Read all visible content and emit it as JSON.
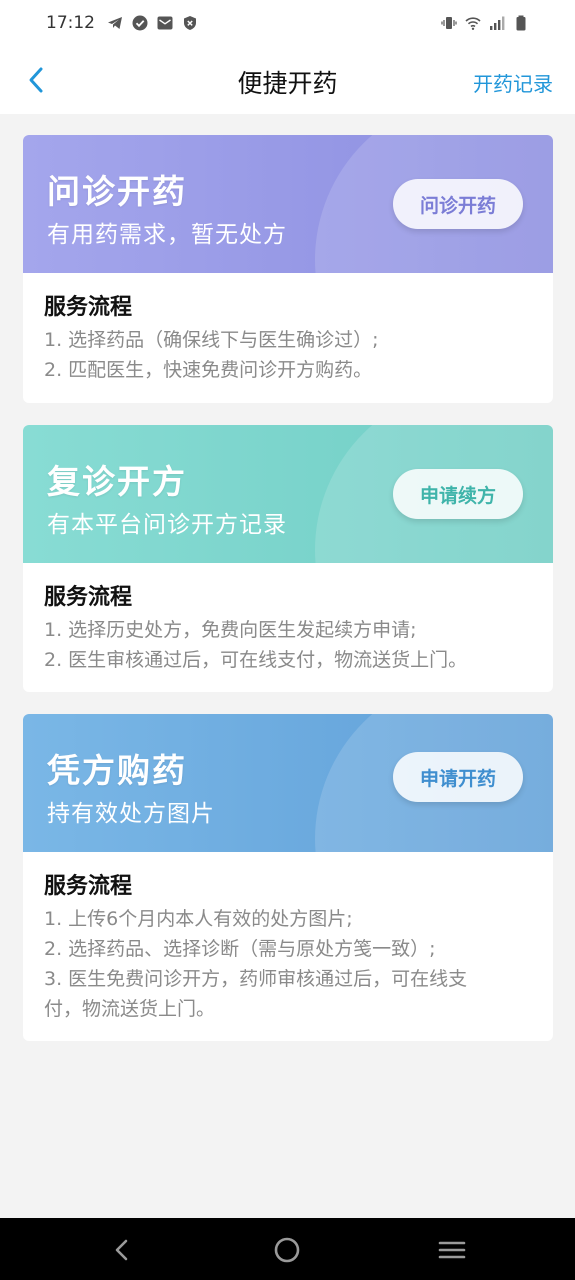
{
  "status_bar": {
    "time": "17:12",
    "left_icons": [
      "telegram-icon",
      "check-circle-icon",
      "mail-icon",
      "shield-icon"
    ],
    "right_icons": [
      "vibrate-icon",
      "wifi-icon",
      "signal-icon",
      "battery-icon"
    ]
  },
  "nav": {
    "back_icon": "chevron-left-icon",
    "title": "便捷开药",
    "right_link": "开药记录"
  },
  "cards": [
    {
      "title": "问诊开药",
      "subtitle": "有用药需求，暂无处方",
      "button": "问诊开药",
      "flow_title": "服务流程",
      "steps": [
        "1. 选择药品（确保线下与医生确诊过）;",
        "2. 匹配医生，快速免费问诊开方购药。"
      ],
      "accent": "#8e8fe0",
      "button_text_color": "#7b7dd6"
    },
    {
      "title": "复诊开方",
      "subtitle": "有本平台问诊开方记录",
      "button": "申请续方",
      "flow_title": "服务流程",
      "steps": [
        "1. 选择历史处方，免费向医生发起续方申请;",
        "2. 医生审核通过后，可在线支付，物流送货上门。"
      ],
      "accent": "#6fcdc4",
      "button_text_color": "#3fb4aa"
    },
    {
      "title": "凭方购药",
      "subtitle": "持有效处方图片",
      "button": "申请开药",
      "flow_title": "服务流程",
      "steps": [
        "1. 上传6个月内本人有效的处方图片;",
        "2. 选择药品、选择诊断（需与原处方笺一致）;",
        "3. 医生免费问诊开方，药师审核通过后，可在线支",
        "付，物流送货上门。"
      ],
      "accent": "#63a7dc",
      "button_text_color": "#3f8ecf"
    }
  ],
  "home_bar": {
    "icons": [
      "back-triangle-icon",
      "home-circle-icon",
      "menu-lines-icon"
    ]
  }
}
